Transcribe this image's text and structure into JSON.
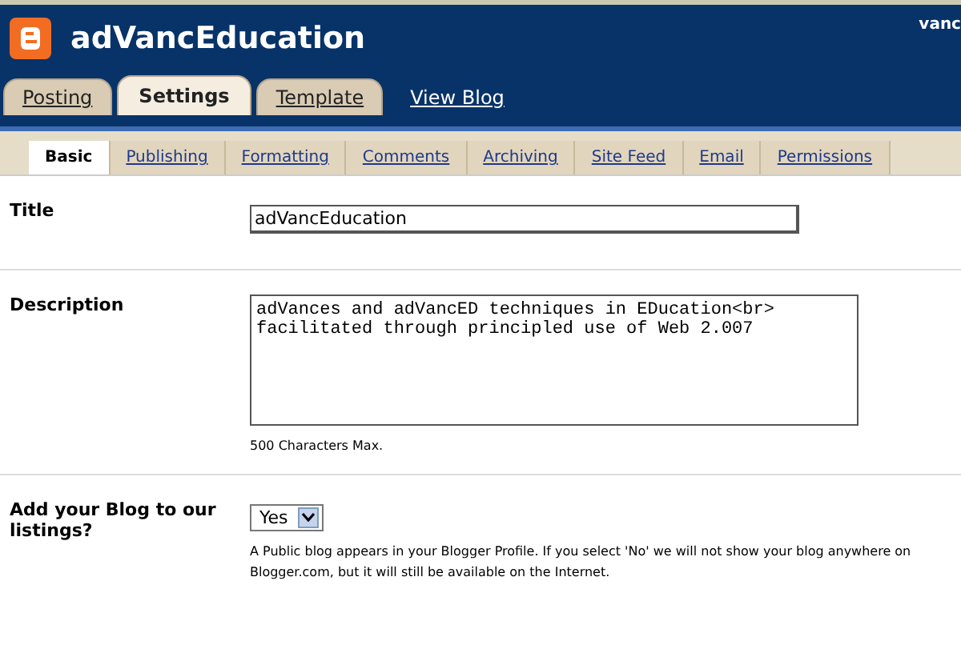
{
  "header": {
    "blog_title": "adVancEducation",
    "user": "vanc"
  },
  "tabs": [
    {
      "label": "Posting",
      "selected": false,
      "kind": "tab"
    },
    {
      "label": "Settings",
      "selected": true,
      "kind": "tab"
    },
    {
      "label": "Template",
      "selected": false,
      "kind": "tab"
    },
    {
      "label": "View Blog",
      "selected": false,
      "kind": "link"
    }
  ],
  "subtabs": [
    {
      "label": "Basic",
      "selected": true
    },
    {
      "label": "Publishing",
      "selected": false
    },
    {
      "label": "Formatting",
      "selected": false
    },
    {
      "label": "Comments",
      "selected": false
    },
    {
      "label": "Archiving",
      "selected": false
    },
    {
      "label": "Site Feed",
      "selected": false
    },
    {
      "label": "Email",
      "selected": false
    },
    {
      "label": "Permissions",
      "selected": false
    }
  ],
  "fields": [
    {
      "kind": "text",
      "label": "Title",
      "value": "adVancEducation"
    },
    {
      "kind": "textarea",
      "label": "Description",
      "value": "adVances and adVancED techniques in EDucation<br>\nfacilitated through principled use of Web 2.007",
      "note": "500 Characters Max."
    },
    {
      "kind": "select",
      "label": "Add your Blog to our listings?",
      "value": "Yes",
      "note": "A Public blog appears in your Blogger Profile. If you select 'No' we will not show your blog anywhere on Blogger.com, but it will still be available on the Internet."
    }
  ]
}
